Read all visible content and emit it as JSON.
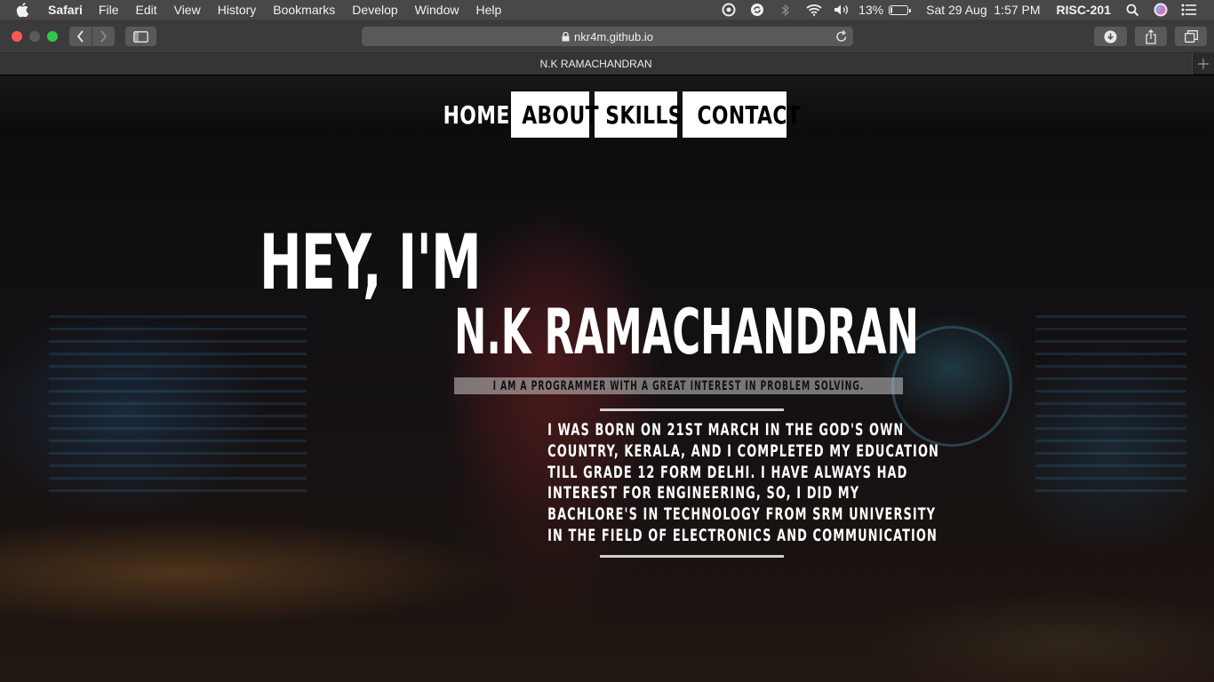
{
  "menubar": {
    "app_name": "Safari",
    "items": [
      "File",
      "Edit",
      "View",
      "History",
      "Bookmarks",
      "Develop",
      "Window",
      "Help"
    ],
    "battery_percent": "13%",
    "battery_level": 0.13,
    "datetime": "Sat 29 Aug  1:57 PM",
    "user": "RISC-201",
    "status_icons": [
      "creative-cloud-icon",
      "sync-icon",
      "bluetooth-icon",
      "wifi-icon",
      "volume-icon",
      "battery-icon",
      "spotlight-icon",
      "siri-icon",
      "notification-center-icon"
    ]
  },
  "toolbar": {
    "url": "nkr4m.github.io"
  },
  "tab": {
    "title": "N.K RAMACHANDRAN"
  },
  "site": {
    "nav": {
      "home": "HOME",
      "about": "ABOUT",
      "skills": "SKILLS",
      "contact": "CONTACT"
    },
    "greeting": "HEY, I'M",
    "name": "N.K RAMACHANDRAN",
    "tagline": "I AM A PROGRAMMER WITH A GREAT INTEREST IN PROBLEM SOLVING.",
    "bio_lines": [
      "I WAS BORN ON 21ST MARCH IN THE GOD'S OWN",
      "COUNTRY, KERALA, AND I COMPLETED MY EDUCATION",
      "TILL GRADE 12 FORM DELHI. I HAVE ALWAYS HAD",
      "INTEREST FOR ENGINEERING, SO, I DID MY",
      "BACHLORE'S IN TECHNOLOGY FROM SRM UNIVERSITY",
      "IN THE FIELD OF ELECTRONICS AND COMMUNICATION"
    ]
  }
}
